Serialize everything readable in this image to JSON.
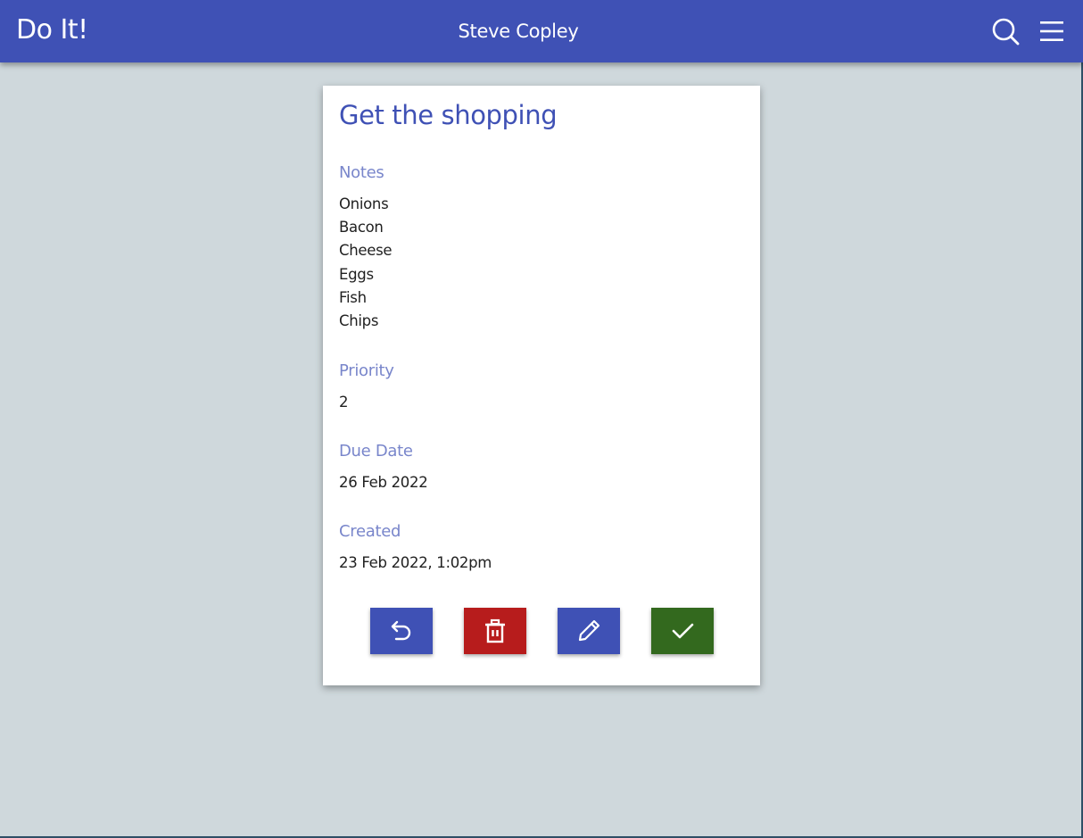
{
  "appbar": {
    "title": "Do It!",
    "user_name": "Steve Copley",
    "icons": [
      "search-icon",
      "menu-icon"
    ]
  },
  "task": {
    "title": "Get the shopping",
    "notes_label": "Notes",
    "notes": [
      "Onions",
      "Bacon",
      "Cheese",
      "Eggs",
      "Fish",
      "Chips"
    ],
    "priority_label": "Priority",
    "priority": "2",
    "due_date_label": "Due Date",
    "due_date": "26 Feb 2022",
    "created_label": "Created",
    "created": "23 Feb 2022, 1:02pm"
  },
  "actions": [
    {
      "name": "back",
      "icon": "undo-icon",
      "color": "#3f51b5"
    },
    {
      "name": "delete",
      "icon": "trash-icon",
      "color": "#b71c1c"
    },
    {
      "name": "edit",
      "icon": "pencil-icon",
      "color": "#3f51b5"
    },
    {
      "name": "complete",
      "icon": "check-icon",
      "color": "#33691e"
    }
  ],
  "colors": {
    "primary": "#3f51b5",
    "label": "#7986cb",
    "background": "#cfd8dc",
    "danger": "#b71c1c",
    "success": "#33691e"
  }
}
